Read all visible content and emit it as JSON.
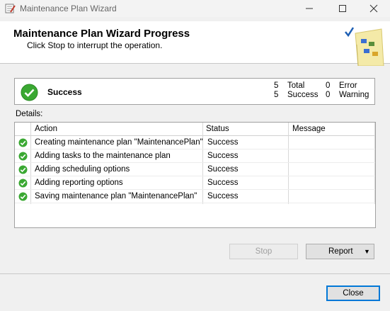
{
  "window": {
    "title": "Maintenance Plan Wizard"
  },
  "header": {
    "title": "Maintenance Plan Wizard Progress",
    "subtitle": "Click Stop to interrupt the operation."
  },
  "summary": {
    "status": "Success",
    "total_count": "5",
    "total_label": "Total",
    "success_count": "5",
    "success_label": "Success",
    "error_count": "0",
    "error_label": "Error",
    "warning_count": "0",
    "warning_label": "Warning"
  },
  "details": {
    "label": "Details:",
    "columns": [
      "Action",
      "Status",
      "Message"
    ],
    "rows": [
      {
        "action": "Creating maintenance plan \"MaintenancePlan\"",
        "status": "Success",
        "message": ""
      },
      {
        "action": "Adding tasks to the maintenance plan",
        "status": "Success",
        "message": ""
      },
      {
        "action": "Adding scheduling options",
        "status": "Success",
        "message": ""
      },
      {
        "action": "Adding reporting options",
        "status": "Success",
        "message": ""
      },
      {
        "action": "Saving maintenance plan \"MaintenancePlan\"",
        "status": "Success",
        "message": ""
      }
    ]
  },
  "buttons": {
    "stop": "Stop",
    "report": "Report",
    "close": "Close"
  },
  "colors": {
    "success_green": "#3aa832",
    "accent_blue": "#0078d7"
  }
}
